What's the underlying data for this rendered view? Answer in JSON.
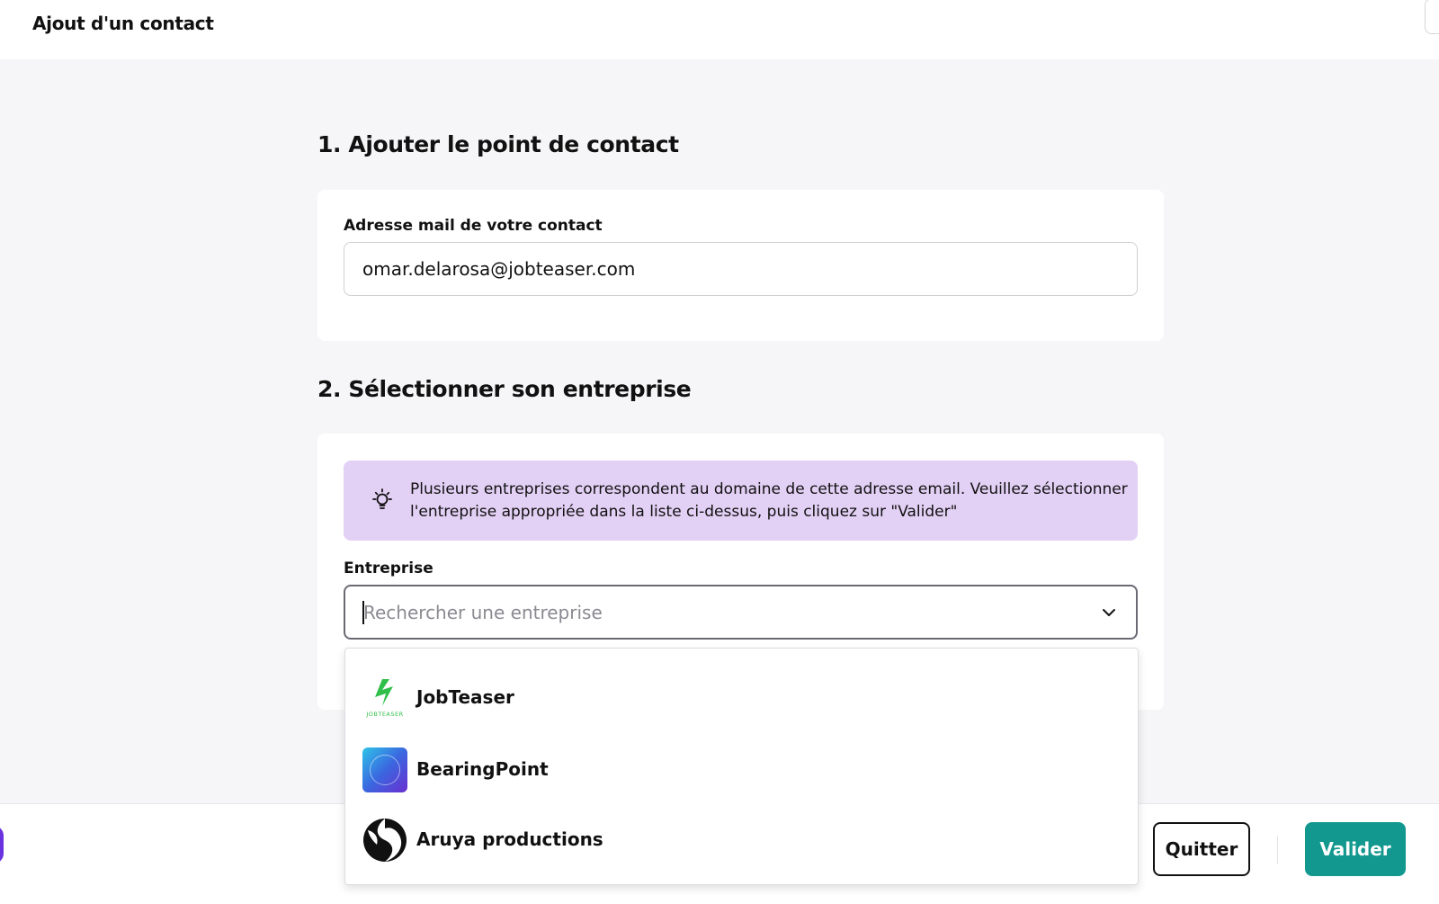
{
  "header": {
    "title": "Ajout d'un contact"
  },
  "section1": {
    "title": "1. Ajouter le point de contact",
    "email_label": "Adresse mail de votre contact",
    "email_value": "omar.delarosa@jobteaser.com"
  },
  "section2": {
    "title": "2. Sélectionner son entreprise",
    "info_message": "Plusieurs entreprises correspondent au domaine de cette adresse email. Veuillez sélectionner l'entreprise appropriée dans la liste ci-dessus, puis cliquez sur \"Valider\"",
    "company_label": "Entreprise",
    "company_placeholder": "Rechercher une entreprise",
    "options": [
      {
        "name": "JobTeaser",
        "icon": "jobteaser-logo"
      },
      {
        "name": "BearingPoint",
        "icon": "bearingpoint-logo"
      },
      {
        "name": "Aruya productions",
        "icon": "aruya-logo"
      }
    ]
  },
  "footer": {
    "quit_label": "Quitter",
    "validate_label": "Valider"
  },
  "colors": {
    "info_background": "#e3d0f5",
    "validate_button": "#12988f",
    "page_background": "#f6f6f8",
    "jobteaser_green": "#2fbf4a"
  }
}
